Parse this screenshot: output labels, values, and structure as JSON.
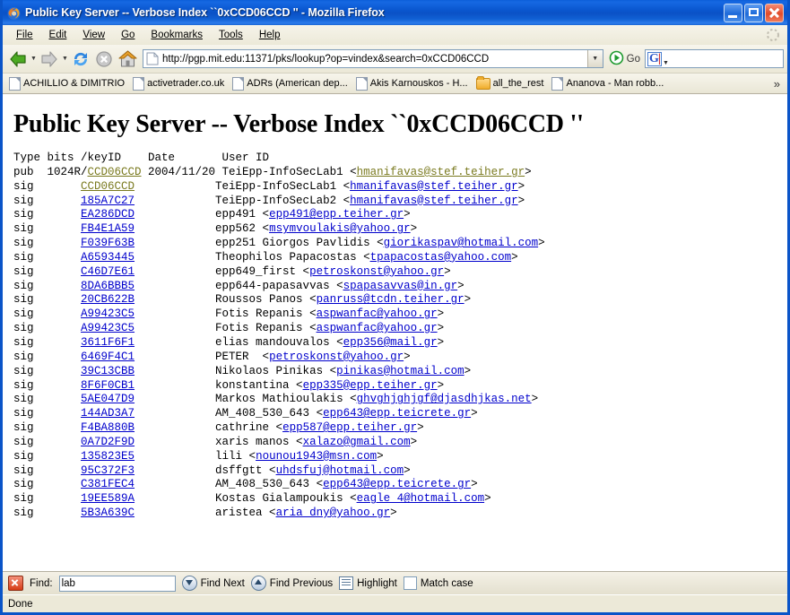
{
  "window": {
    "title": "Public Key Server -- Verbose Index ``0xCCD06CCD '' - Mozilla Firefox",
    "app_icon": "firefox-icon",
    "minimize_label": "Minimize",
    "maximize_label": "Maximize",
    "close_label": "Close"
  },
  "menubar": {
    "items": [
      {
        "label": "File",
        "accel": "F"
      },
      {
        "label": "Edit",
        "accel": "E"
      },
      {
        "label": "View",
        "accel": "V"
      },
      {
        "label": "Go",
        "accel": "G"
      },
      {
        "label": "Bookmarks",
        "accel": "B"
      },
      {
        "label": "Tools",
        "accel": "T"
      },
      {
        "label": "Help",
        "accel": "H"
      }
    ]
  },
  "navbar": {
    "back_icon": "back-arrow-icon",
    "forward_icon": "forward-arrow-icon",
    "reload_icon": "reload-icon",
    "stop_icon": "stop-icon",
    "home_icon": "home-icon",
    "url": "http://pgp.mit.edu:11371/pks/lookup?op=vindex&search=0xCCD06CCD",
    "url_placeholder": "",
    "go_label": "Go",
    "go_icon": "go-arrow-icon",
    "search_value": "",
    "search_placeholder": "",
    "search_engine_icon": "google-icon",
    "search_engine_letter": "G"
  },
  "bookmarks": {
    "items": [
      {
        "label": "ACHILLIO & DIMITRIO",
        "icon": "bookmark-page-icon"
      },
      {
        "label": "activetrader.co.uk",
        "icon": "bookmark-page-icon"
      },
      {
        "label": "ADRs (American dep...",
        "icon": "bookmark-page-icon"
      },
      {
        "label": "Akis Karnouskos - H...",
        "icon": "bookmark-page-icon"
      },
      {
        "label": "all_the_rest",
        "icon": "bookmark-folder-icon"
      },
      {
        "label": "Ananova - Man robb...",
        "icon": "bookmark-page-icon"
      }
    ],
    "overflow_label": "»"
  },
  "page": {
    "heading": "Public Key Server -- Verbose Index ``0xCCD06CCD ''",
    "columns": {
      "type": "Type",
      "bits_keyid": "bits /keyID",
      "date": "Date",
      "userid": "User ID"
    },
    "header_line": "Type bits /keyID    Date       User ID",
    "rows": [
      {
        "type": "pub",
        "bits": "1024R/",
        "keyid": "CCD06CCD",
        "keyid_visited": true,
        "date": "2004/11/20",
        "name": "TeiEpp-InfoSecLab1",
        "email": "hmanifavas@stef.teiher.gr",
        "email_visited": true
      },
      {
        "type": "sig",
        "bits": "",
        "keyid": "CCD06CCD",
        "keyid_visited": true,
        "date": "",
        "name": "TeiEpp-InfoSecLab1",
        "email": "hmanifavas@stef.teiher.gr",
        "email_visited": false
      },
      {
        "type": "sig",
        "bits": "",
        "keyid": "185A7C27",
        "keyid_visited": false,
        "date": "",
        "name": "TeiEpp-InfoSecLab2",
        "email": "hmanifavas@stef.teiher.gr",
        "email_visited": false
      },
      {
        "type": "sig",
        "bits": "",
        "keyid": "EA286DCD",
        "keyid_visited": false,
        "date": "",
        "name": "epp491",
        "email": "epp491@epp.teiher.gr",
        "email_visited": false
      },
      {
        "type": "sig",
        "bits": "",
        "keyid": "FB4E1A59",
        "keyid_visited": false,
        "date": "",
        "name": "epp562",
        "email": "msymvoulakis@yahoo.gr",
        "email_visited": false
      },
      {
        "type": "sig",
        "bits": "",
        "keyid": "F039F63B",
        "keyid_visited": false,
        "date": "",
        "name": "epp251 Giorgos Pavlidis",
        "email": "giorikaspav@hotmail.com",
        "email_visited": false
      },
      {
        "type": "sig",
        "bits": "",
        "keyid": "A6593445",
        "keyid_visited": false,
        "date": "",
        "name": "Theophilos Papacostas",
        "email": "tpapacostas@yahoo.com",
        "email_visited": false
      },
      {
        "type": "sig",
        "bits": "",
        "keyid": "C46D7E61",
        "keyid_visited": false,
        "date": "",
        "name": "epp649_first",
        "email": "petroskonst@yahoo.gr",
        "email_visited": false
      },
      {
        "type": "sig",
        "bits": "",
        "keyid": "8DA6BBB5",
        "keyid_visited": false,
        "date": "",
        "name": "epp644-papasavvas",
        "email": "spapasavvas@in.gr",
        "email_visited": false
      },
      {
        "type": "sig",
        "bits": "",
        "keyid": "20CB622B",
        "keyid_visited": false,
        "date": "",
        "name": "Roussos Panos",
        "email": "panruss@tcdn.teiher.gr",
        "email_visited": false
      },
      {
        "type": "sig",
        "bits": "",
        "keyid": "A99423C5",
        "keyid_visited": false,
        "date": "",
        "name": "Fotis Repanis",
        "email": "aspwanfac@yahoo.gr",
        "email_visited": false
      },
      {
        "type": "sig",
        "bits": "",
        "keyid": "A99423C5",
        "keyid_visited": false,
        "date": "",
        "name": "Fotis Repanis",
        "email": "aspwanfac@yahoo.gr",
        "email_visited": false
      },
      {
        "type": "sig",
        "bits": "",
        "keyid": "3611F6F1",
        "keyid_visited": false,
        "date": "",
        "name": "elias mandouvalos",
        "email": "epp356@mail.gr",
        "email_visited": false
      },
      {
        "type": "sig",
        "bits": "",
        "keyid": "6469F4C1",
        "keyid_visited": false,
        "date": "",
        "name": "PETER ",
        "email": "petroskonst@yahoo.gr",
        "email_visited": false
      },
      {
        "type": "sig",
        "bits": "",
        "keyid": "39C13CBB",
        "keyid_visited": false,
        "date": "",
        "name": "Nikolaos Pinikas",
        "email": "pinikas@hotmail.com",
        "email_visited": false
      },
      {
        "type": "sig",
        "bits": "",
        "keyid": "8F6F0CB1",
        "keyid_visited": false,
        "date": "",
        "name": "konstantina",
        "email": "epp335@epp.teiher.gr",
        "email_visited": false
      },
      {
        "type": "sig",
        "bits": "",
        "keyid": "5AE047D9",
        "keyid_visited": false,
        "date": "",
        "name": "Markos Mathioulakis",
        "email": "ghvghjghjgf@djasdhjkas.net",
        "email_visited": false
      },
      {
        "type": "sig",
        "bits": "",
        "keyid": "144AD3A7",
        "keyid_visited": false,
        "date": "",
        "name": "AM_408_530_643",
        "email": "epp643@epp.teicrete.gr",
        "email_visited": false
      },
      {
        "type": "sig",
        "bits": "",
        "keyid": "F4BA880B",
        "keyid_visited": false,
        "date": "",
        "name": "cathrine",
        "email": "epp587@epp.teiher.gr",
        "email_visited": false
      },
      {
        "type": "sig",
        "bits": "",
        "keyid": "0A7D2F9D",
        "keyid_visited": false,
        "date": "",
        "name": "xaris manos",
        "email": "xalazo@gmail.com",
        "email_visited": false
      },
      {
        "type": "sig",
        "bits": "",
        "keyid": "135823E5",
        "keyid_visited": false,
        "date": "",
        "name": "lili",
        "email": "nounou1943@msn.com",
        "email_visited": false
      },
      {
        "type": "sig",
        "bits": "",
        "keyid": "95C372F3",
        "keyid_visited": false,
        "date": "",
        "name": "dsffgtt",
        "email": "uhdsfuj@hotmail.com",
        "email_visited": false
      },
      {
        "type": "sig",
        "bits": "",
        "keyid": "C381FEC4",
        "keyid_visited": false,
        "date": "",
        "name": "AM_408_530_643",
        "email": "epp643@epp.teicrete.gr",
        "email_visited": false
      },
      {
        "type": "sig",
        "bits": "",
        "keyid": "19EE589A",
        "keyid_visited": false,
        "date": "",
        "name": "Kostas Gialampoukis",
        "email": "eagle_4@hotmail.com",
        "email_visited": false
      },
      {
        "type": "sig",
        "bits": "",
        "keyid": "5B3A639C",
        "keyid_visited": false,
        "date": "",
        "name": "aristea",
        "email": "aria_dny@yahoo.gr",
        "email_visited": false
      }
    ]
  },
  "findbar": {
    "close_icon": "close-findbar-icon",
    "label": "Find:",
    "value": "lab",
    "placeholder": "",
    "find_next": "Find Next",
    "find_previous": "Find Previous",
    "highlight": "Highlight",
    "match_case": "Match case",
    "match_case_checked": false
  },
  "statusbar": {
    "text": "Done"
  },
  "colors": {
    "title_blue": "#0a54c8",
    "chrome_bg": "#ece9d8",
    "link": "#0000cc",
    "visited_link": "#7a7a1f",
    "page_bg": "#ffffff"
  }
}
